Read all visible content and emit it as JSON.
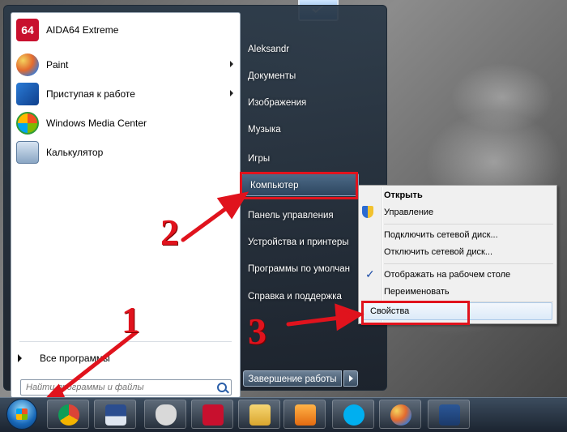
{
  "start_menu": {
    "programs": [
      {
        "label": "AIDA64 Extreme",
        "icon": "aida64-icon",
        "has_submenu": false
      },
      {
        "label": "Paint",
        "icon": "paint-icon",
        "has_submenu": true
      },
      {
        "label": "Приступая к работе",
        "icon": "getting-started-icon",
        "has_submenu": true
      },
      {
        "label": "Windows Media Center",
        "icon": "media-center-icon",
        "has_submenu": false
      },
      {
        "label": "Калькулятор",
        "icon": "calculator-icon",
        "has_submenu": false
      }
    ],
    "all_programs": "Все программы",
    "search_placeholder": "Найти программы и файлы",
    "right_items": [
      "Aleksandr",
      "Документы",
      "Изображения",
      "Музыка",
      "Игры",
      "Компьютер",
      "Панель управления",
      "Устройства и принтеры",
      "Программы по умолчан",
      "Справка и поддержка"
    ],
    "shutdown": "Завершение работы"
  },
  "context_menu": {
    "items": [
      "Открыть",
      "Управление",
      "Подключить сетевой диск...",
      "Отключить сетевой диск...",
      "Отображать на рабочем столе",
      "Переименовать",
      "Свойства"
    ]
  },
  "annotations": {
    "step1": "1",
    "step2": "2",
    "step3": "3",
    "color": "#e0131d"
  },
  "taskbar": {
    "apps": [
      "chrome-icon",
      "save-floppy-icon",
      "alien-icon",
      "aida64-icon",
      "folder-icon",
      "media-player-icon",
      "skype-icon",
      "paint-icon",
      "word-icon"
    ]
  }
}
